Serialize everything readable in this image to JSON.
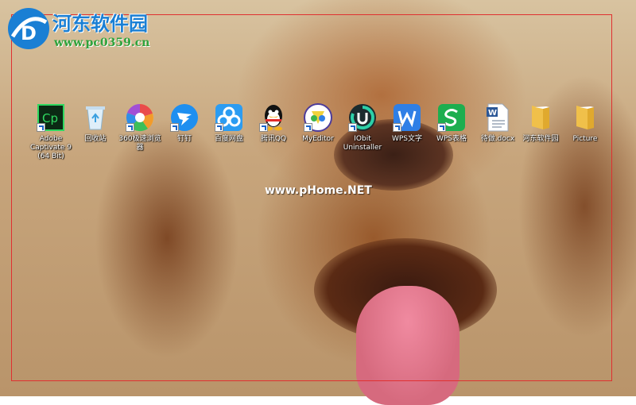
{
  "watermark_site": {
    "name": "河东软件园",
    "url": "www.pc0359.cn"
  },
  "center_watermark": "www.pHome.NET",
  "desktop_icons": [
    {
      "label": "Adobe Captivate 9 (64 Bit)",
      "icon": "adobe-captivate-icon",
      "color": "#0f5a2a"
    },
    {
      "label": "回收站",
      "icon": "recycle-bin-icon",
      "color": "#c9e7f7"
    },
    {
      "label": "360极速浏览器",
      "icon": "360-browser-icon",
      "color": "#e94b4b"
    },
    {
      "label": "钉钉",
      "icon": "dingtalk-icon",
      "color": "#1e8ff0"
    },
    {
      "label": "百度网盘",
      "icon": "baidu-netdisk-icon",
      "color": "#2b9cf2"
    },
    {
      "label": "腾讯QQ",
      "icon": "qq-penguin-icon",
      "color": "#111111"
    },
    {
      "label": "MyEditor",
      "icon": "myeditor-icon",
      "color": "#f0d23c"
    },
    {
      "label": "IObit Uninstaller",
      "icon": "iobit-uninstaller-icon",
      "color": "#1f8a7a"
    },
    {
      "label": "WPS文字",
      "icon": "wps-writer-icon",
      "color": "#2f7fe6"
    },
    {
      "label": "WPS表格",
      "icon": "wps-spreadsheet-icon",
      "color": "#1dae4f"
    },
    {
      "label": "待做.docx",
      "icon": "word-document-icon",
      "color": "#2b5797"
    },
    {
      "label": "河东软件园",
      "icon": "folder-icon",
      "color": "#f0c04a"
    },
    {
      "label": "Picture",
      "icon": "folder-icon",
      "color": "#f0c04a"
    }
  ]
}
